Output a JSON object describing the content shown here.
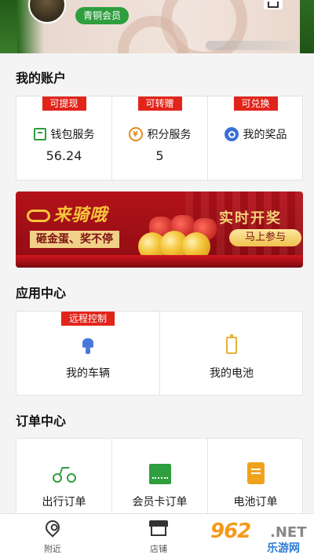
{
  "header": {
    "member_badge": "青铜会员"
  },
  "account": {
    "title": "我的账户",
    "items": [
      {
        "tag": "可提现",
        "label": "钱包服务",
        "value": "56.24",
        "icon": "wallet-icon"
      },
      {
        "tag": "可转赠",
        "label": "积分服务",
        "value": "5",
        "icon": "points-icon",
        "icon_glyph": "¥"
      },
      {
        "tag": "可兑换",
        "label": "我的奖品",
        "value": "",
        "icon": "prize-icon"
      }
    ]
  },
  "promo": {
    "logo": "来骑哦",
    "slogan": "砸金蛋、奖不停",
    "headline": "实时开奖",
    "cta": "马上参与"
  },
  "apps": {
    "title": "应用中心",
    "items": [
      {
        "tag": "远程控制",
        "label": "我的车辆",
        "icon": "scooter-icon"
      },
      {
        "tag": "",
        "label": "我的电池",
        "icon": "battery-icon"
      }
    ]
  },
  "orders": {
    "title": "订单中心",
    "items": [
      {
        "label": "出行订单",
        "icon": "bicycle-icon"
      },
      {
        "label": "会员卡订单",
        "icon": "card-icon"
      },
      {
        "label": "电池订单",
        "icon": "clipboard-icon"
      }
    ]
  },
  "tabbar": {
    "items": [
      {
        "label": "附近",
        "icon": "location-pin-icon"
      },
      {
        "label": "店铺",
        "icon": "shop-icon"
      }
    ]
  },
  "watermark": {
    "big": "962",
    "net": ".NET",
    "cn": "乐游网"
  },
  "colors": {
    "accent_green": "#2e9e3e",
    "tag_red": "#e1251b",
    "promo_red": "#b4121a"
  }
}
